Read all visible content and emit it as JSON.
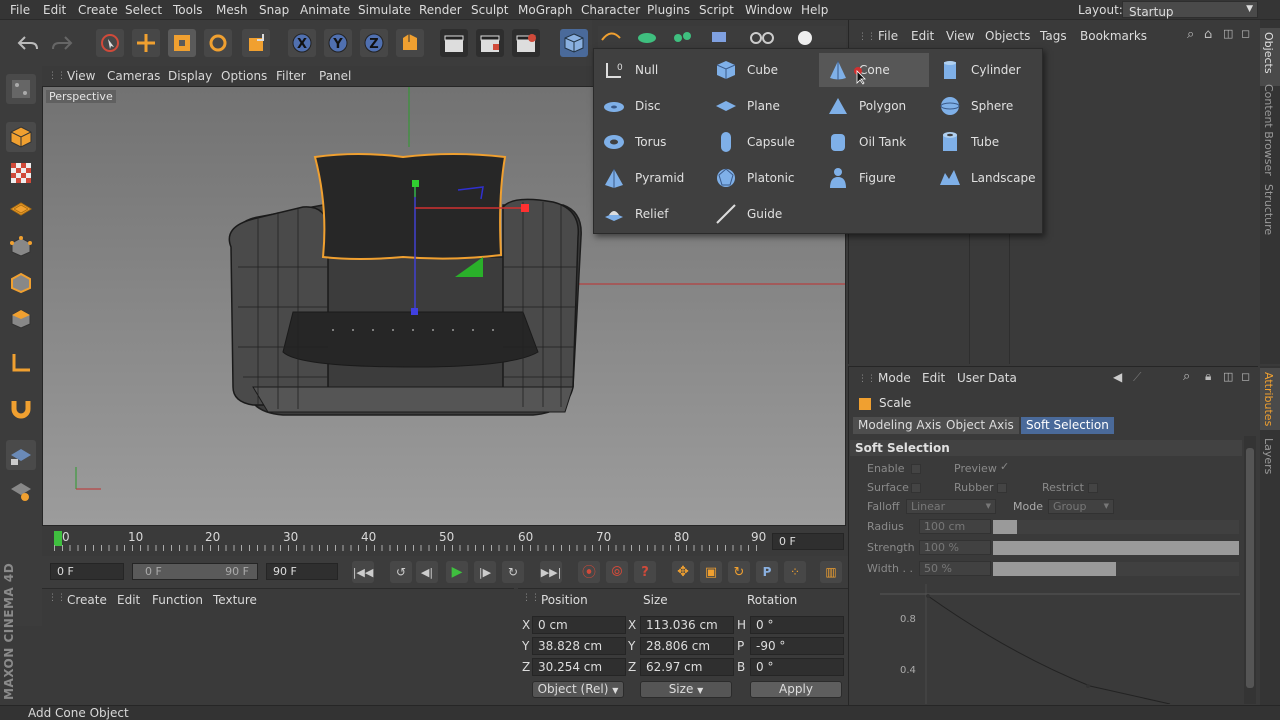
{
  "menubar": {
    "items": [
      "File",
      "Edit",
      "Create",
      "Select",
      "Tools",
      "Mesh",
      "Snap",
      "Animate",
      "Simulate",
      "Render",
      "Sculpt",
      "MoGraph",
      "Character",
      "Plugins",
      "Script",
      "Window",
      "Help"
    ],
    "layout_label": "Layout:",
    "layout_value": "Startup"
  },
  "viewport": {
    "menu": [
      "View",
      "Cameras",
      "Display",
      "Options",
      "Filter",
      "Panel"
    ],
    "label": "Perspective"
  },
  "timeline": {
    "ticks": [
      "0",
      "10",
      "20",
      "30",
      "40",
      "50",
      "60",
      "70",
      "80",
      "90"
    ],
    "current_frame": "0 F"
  },
  "playback": {
    "start": "0 F",
    "range_start": "0 F",
    "range_end": "90 F",
    "end": "90 F"
  },
  "material_manager": {
    "menu": [
      "Create",
      "Edit",
      "Function",
      "Texture"
    ]
  },
  "coordinates": {
    "headers": {
      "position": "Position",
      "size": "Size",
      "rotation": "Rotation"
    },
    "rows": [
      {
        "axis": "X",
        "pos": "0 cm",
        "size_axis": "X",
        "size": "113.036 cm",
        "rot_axis": "H",
        "rot": "0 °"
      },
      {
        "axis": "Y",
        "pos": "38.828 cm",
        "size_axis": "Y",
        "size": "28.806 cm",
        "rot_axis": "P",
        "rot": "-90 °"
      },
      {
        "axis": "Z",
        "pos": "30.254 cm",
        "size_axis": "Z",
        "size": "62.97 cm",
        "rot_axis": "B",
        "rot": "0 °"
      }
    ],
    "mode_select": "Object (Rel)",
    "size_select": "Size",
    "apply": "Apply"
  },
  "status": "Add Cone Object",
  "object_manager": {
    "menu": [
      "File",
      "Edit",
      "View",
      "Objects",
      "Tags",
      "Bookmarks"
    ]
  },
  "attributes": {
    "menu": [
      "Mode",
      "Edit",
      "User Data"
    ],
    "tool_name": "Scale",
    "tabs": [
      "Modeling Axis",
      "Object Axis",
      "Soft Selection"
    ],
    "section": "Soft Selection",
    "enable": "Enable",
    "preview": "Preview",
    "surface": "Surface",
    "rubber": "Rubber",
    "restrict": "Restrict",
    "falloff": "Falloff",
    "falloff_value": "Linear",
    "mode": "Mode",
    "mode_value": "Group",
    "radius": "Radius",
    "radius_value": "100 cm",
    "strength": "Strength",
    "strength_value": "100 %",
    "width": "Width . .",
    "width_value": "50 %",
    "graph_labels": [
      "0.8",
      "0.4"
    ]
  },
  "side_tabs": {
    "right_top": [
      "Objects",
      "Content Browser",
      "Structure"
    ],
    "right_bottom": [
      "Attributes",
      "Layers"
    ]
  },
  "branding": "MAXON CINEMA 4D",
  "primitives_popup": {
    "columns": [
      [
        "Null",
        "Disc",
        "Torus",
        "Pyramid",
        "Relief"
      ],
      [
        "Cube",
        "Plane",
        "Capsule",
        "Platonic",
        "Guide"
      ],
      [
        "Cone",
        "Polygon",
        "Oil Tank",
        "Figure"
      ],
      [
        "Cylinder",
        "Sphere",
        "Tube",
        "Landscape"
      ]
    ],
    "hovered": "Cone"
  },
  "colors": {
    "accent_blue": "#4a6a9a",
    "selection_orange": "#f0a030",
    "play_green": "#3fbf3f",
    "record_red": "#d04a3a"
  }
}
